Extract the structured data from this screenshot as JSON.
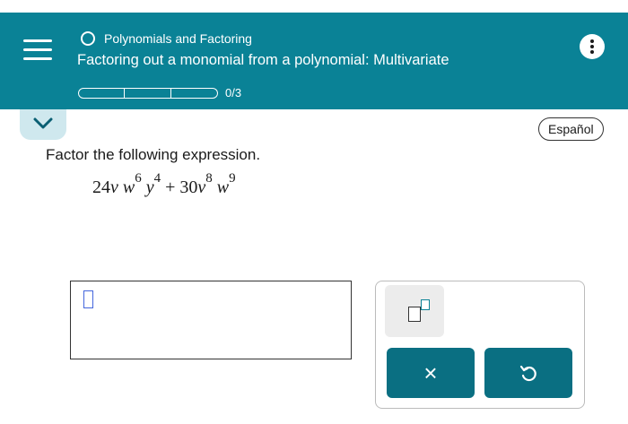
{
  "header": {
    "topic": "Polynomials and Factoring",
    "title": "Factoring out a monomial from a polynomial: Multivariate",
    "progress_text": "0/3",
    "progress": {
      "completed": 0,
      "total": 3
    },
    "bg_color": "#0a8296"
  },
  "language_button": "Español",
  "question": {
    "prompt": "Factor the following expression.",
    "expression": {
      "coef1": "24",
      "v1": "v",
      "w1": "w",
      "w1_exp": "6",
      "y1": "y",
      "y1_exp": "4",
      "plus": "+",
      "coef2": "30",
      "v2": "v",
      "v2_exp": "8",
      "w2": "w",
      "w2_exp": "9"
    }
  },
  "answer": {
    "value": ""
  },
  "keypad": {
    "exponent_icon": "exponent-template-icon",
    "clear_label": "×",
    "undo_icon": "undo-icon",
    "button_color": "#0a6f82"
  }
}
